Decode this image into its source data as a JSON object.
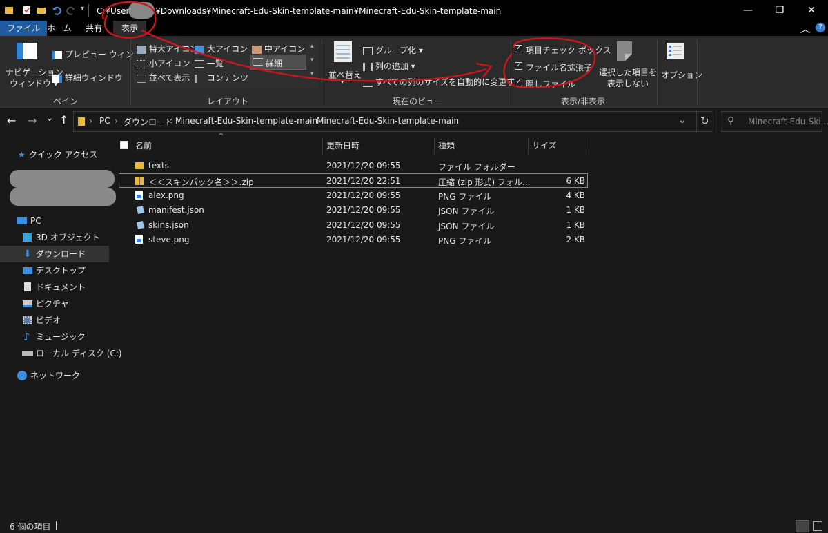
{
  "window": {
    "address_path": "C:¥Users¥　　¥Downloads¥Minecraft-Edu-Skin-template-main¥Minecraft-Edu-Skin-template-main",
    "quick_access_dropdown": "▾",
    "min": "—",
    "max": "❐",
    "close": "✕"
  },
  "tabs": {
    "file": "ファイル",
    "home": "ホーム",
    "share": "共有",
    "view": "表示",
    "collapse": "︿",
    "help": "?"
  },
  "ribbon": {
    "pane": {
      "nav_pane_1": "ナビゲーション",
      "nav_pane_2": "ウィンドウ ▾",
      "preview": "プレビュー ウィンドウ",
      "details_pane": "詳細ウィンドウ",
      "label": "ペイン"
    },
    "layout": {
      "xl_icons": "特大アイコン",
      "l_icons": "大アイコン",
      "m_icons": "中アイコン",
      "s_icons": "小アイコン",
      "list": "一覧",
      "details": "詳細",
      "tiles": "並べて表示",
      "content": "コンテンツ",
      "label": "レイアウト"
    },
    "current_view": {
      "sort_1": "並べ替え",
      "sort_2": "▾",
      "group": "グループ化 ▾",
      "add_col": "列の追加 ▾",
      "fit_cols": "すべての列のサイズを自動的に変更する",
      "label": "現在のビュー"
    },
    "show_hide": {
      "item_checkbox": "項目チェック ボックス",
      "file_ext": "ファイル名拡張子",
      "hidden": "隠しファイル",
      "hide_sel_1": "選択した項目を",
      "hide_sel_2": "表示しない",
      "label": "表示/非表示",
      "check_mark": "✓"
    },
    "options": "オプション"
  },
  "nav": {
    "back": "←",
    "forward": "→",
    "recent": "⌄",
    "up": "↑",
    "breadcrumb": [
      "PC",
      "ダウンロード",
      "Minecraft-Edu-Skin-template-main",
      "Minecraft-Edu-Skin-template-main"
    ],
    "sep": "›",
    "dropdown": "⌄",
    "refresh": "↻",
    "search_placeholder": "Minecraft-Edu-Ski...",
    "search_icon": "⚲"
  },
  "sidebar": {
    "quick_access": "クイック アクセス",
    "pc": "PC",
    "items": [
      "3D オブジェクト",
      "ダウンロード",
      "デスクトップ",
      "ドキュメント",
      "ピクチャ",
      "ビデオ",
      "ミュージック",
      "ローカル ディスク (C:)"
    ],
    "network": "ネットワーク"
  },
  "columns": {
    "name": "名前",
    "date": "更新日時",
    "type": "種類",
    "size": "サイズ",
    "sort_arrow": "^"
  },
  "files": [
    {
      "name": "texts",
      "date": "2021/12/20 09:55",
      "type": "ファイル フォルダー",
      "size": ""
    },
    {
      "name": "＜＜スキンパック名＞＞.zip",
      "date": "2021/12/20 22:51",
      "type": "圧縮 (zip 形式) フォル...",
      "size": "6 KB"
    },
    {
      "name": "alex.png",
      "date": "2021/12/20 09:55",
      "type": "PNG ファイル",
      "size": "4 KB"
    },
    {
      "name": "manifest.json",
      "date": "2021/12/20 09:55",
      "type": "JSON ファイル",
      "size": "1 KB"
    },
    {
      "name": "skins.json",
      "date": "2021/12/20 09:55",
      "type": "JSON ファイル",
      "size": "1 KB"
    },
    {
      "name": "steve.png",
      "date": "2021/12/20 09:55",
      "type": "PNG ファイル",
      "size": "2 KB"
    }
  ],
  "status": {
    "count": "6 個の項目"
  },
  "colors": {
    "annotation": "#c8171d",
    "accent": "#1f5b9e",
    "folder": "#e8b93f"
  }
}
